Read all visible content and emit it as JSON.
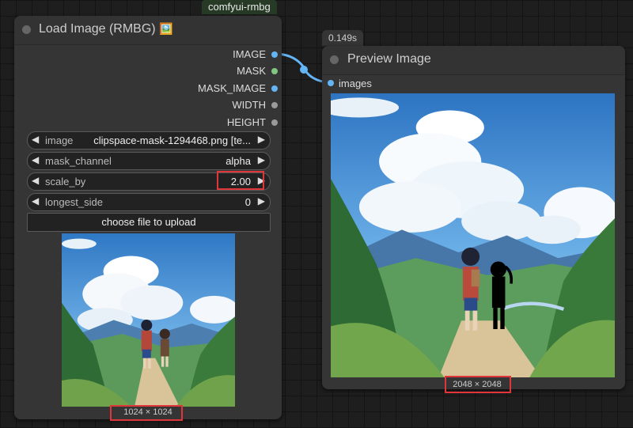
{
  "group_tag": "comfyui-rmbg",
  "load_node": {
    "title": "Load Image (RMBG)",
    "emoji": "🖼️",
    "outputs": [
      {
        "label": "IMAGE",
        "color": "#64b5f6"
      },
      {
        "label": "MASK",
        "color": "#81c784"
      },
      {
        "label": "MASK_IMAGE",
        "color": "#64b5f6"
      },
      {
        "label": "WIDTH",
        "color": "#9a9a9a"
      },
      {
        "label": "HEIGHT",
        "color": "#9a9a9a"
      }
    ],
    "widgets": {
      "image": {
        "label": "image",
        "value": "clipspace-mask-1294468.png [te..."
      },
      "mask_channel": {
        "label": "mask_channel",
        "value": "alpha"
      },
      "scale_by": {
        "label": "scale_by",
        "value": "2.00"
      },
      "longest_side": {
        "label": "longest_side",
        "value": "0"
      }
    },
    "upload_button": "choose file to upload",
    "dimensions": "1024 × 1024"
  },
  "preview_node": {
    "timing": "0.149s",
    "title": "Preview Image",
    "input_label": "images",
    "dimensions": "2048 × 2048"
  },
  "colors": {
    "link": "#64b5f6",
    "highlight": "#e0353b"
  }
}
